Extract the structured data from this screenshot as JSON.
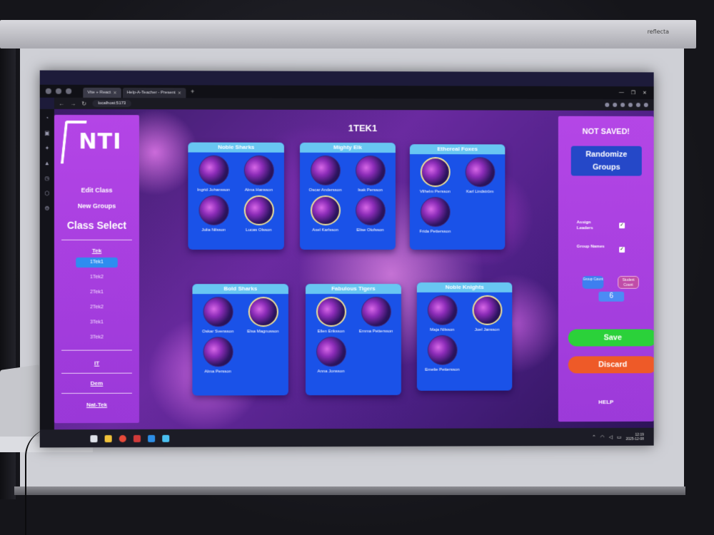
{
  "projector": {
    "brand": "reflecta"
  },
  "browser": {
    "tabs": [
      {
        "label": "Vite + React",
        "active": true
      },
      {
        "label": "Help-A-Teacher - Present",
        "active": false
      }
    ],
    "new_tab": "+",
    "url": "localhost:5173",
    "nav": {
      "back": "←",
      "forward": "→",
      "reload": "↻"
    },
    "window_controls": [
      "—",
      "❐",
      "✕"
    ]
  },
  "sidebar_left": {
    "logo_text": "NTI",
    "edit_class": "Edit Class",
    "new_groups": "New Groups",
    "class_select_title": "Class Select",
    "categories": [
      {
        "label": "Tek",
        "classes": [
          "1Tek1",
          "1Tek2",
          "2Tek1",
          "2Tek2",
          "3Tek1",
          "3Tek2"
        ],
        "selected": "1Tek1"
      },
      {
        "label": "IT"
      },
      {
        "label": "Dem"
      },
      {
        "label": "Nat-Tek"
      }
    ]
  },
  "main": {
    "title": "1TEK1",
    "groups": [
      {
        "name": "Noble Sharks",
        "members": [
          {
            "name": "Ingrid Johansson",
            "leader": false
          },
          {
            "name": "Alma Hansson",
            "leader": false
          },
          {
            "name": "Julia Nilsson",
            "leader": false
          },
          {
            "name": "Lucas Olsson",
            "leader": true
          }
        ]
      },
      {
        "name": "Mighty Elk",
        "members": [
          {
            "name": "Oscar Andersson",
            "leader": false
          },
          {
            "name": "Isak Persson",
            "leader": false
          },
          {
            "name": "Axel Karlsson",
            "leader": true
          },
          {
            "name": "Elise Olofsson",
            "leader": false
          }
        ]
      },
      {
        "name": "Ethereal Foxes",
        "members": [
          {
            "name": "Vilhelm Persson",
            "leader": true
          },
          {
            "name": "Karl Lindström",
            "leader": false
          },
          {
            "name": "Frida Pettersson",
            "leader": false
          }
        ]
      },
      {
        "name": "Bold Sharks",
        "members": [
          {
            "name": "Oskar Svensson",
            "leader": false
          },
          {
            "name": "Elsa Magnusson",
            "leader": true
          },
          {
            "name": "Alma Persson",
            "leader": false
          }
        ]
      },
      {
        "name": "Fabulous Tigers",
        "members": [
          {
            "name": "Ellen Eriksson",
            "leader": true
          },
          {
            "name": "Emma Pettersson",
            "leader": false
          },
          {
            "name": "Anna Jonsson",
            "leader": false
          }
        ]
      },
      {
        "name": "Noble Knights",
        "members": [
          {
            "name": "Maja Nilsson",
            "leader": false
          },
          {
            "name": "Joel Jansson",
            "leader": true
          },
          {
            "name": "Emelie Pettersson",
            "leader": false
          }
        ]
      }
    ]
  },
  "sidebar_right": {
    "status": "NOT SAVED!",
    "randomize_label": "Randomize Groups",
    "assign_leaders_label": "Assign Leaders",
    "assign_leaders_checked": true,
    "group_names_label": "Group Names",
    "group_names_checked": true,
    "group_count_label": "Group Count",
    "student_count_label": "Student Count",
    "count_value": "6",
    "save_label": "Save",
    "discard_label": "Discard",
    "help_label": "HELP"
  },
  "taskbar": {
    "time": "12:19",
    "date": "2025-12-08"
  },
  "colors": {
    "panel": "#b445e6",
    "card": "#1a52e8",
    "card_header": "#68c6f2",
    "save": "#2bd13a",
    "discard": "#ee5a28",
    "leader_ring": "#f0e39a"
  }
}
